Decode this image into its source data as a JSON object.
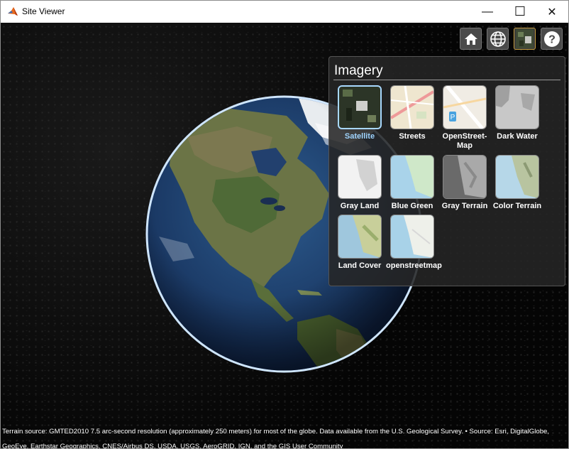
{
  "window": {
    "title": "Site Viewer",
    "controls": {
      "minimize": "—",
      "maximize": "☐",
      "close": "✕"
    }
  },
  "toolbar": {
    "buttons": [
      {
        "name": "home",
        "icon": "home-icon"
      },
      {
        "name": "basemap",
        "icon": "globe-icon"
      },
      {
        "name": "imagery",
        "icon": "imagery-icon",
        "active": true
      },
      {
        "name": "help",
        "icon": "help-icon",
        "label": "?"
      }
    ]
  },
  "imagery_panel": {
    "title": "Imagery",
    "options": [
      {
        "label": "Satellite",
        "selected": true
      },
      {
        "label": "Streets"
      },
      {
        "label": "OpenStreet-Map"
      },
      {
        "label": "Dark Water"
      },
      {
        "label": "Gray Land"
      },
      {
        "label": "Blue Green"
      },
      {
        "label": "Gray Terrain"
      },
      {
        "label": "Color Terrain"
      },
      {
        "label": "Land Cover"
      },
      {
        "label": "openstreetmap"
      }
    ]
  },
  "attribution": "Terrain source: GMTED2010 7.5 arc-second resolution (approximately 250 meters) for most of the globe. Data available from the U.S. Geological Survey. • Source: Esri, DigitalGlobe, GeoEye, Earthstar Geographics, CNES/Airbus DS, USDA, USGS, AeroGRID, IGN, and the GIS User Community",
  "colors": {
    "selection": "#9fd4ff",
    "panel_bg": "#262626",
    "ocean": "#1e3a6a",
    "land": "#5f6d3a"
  }
}
